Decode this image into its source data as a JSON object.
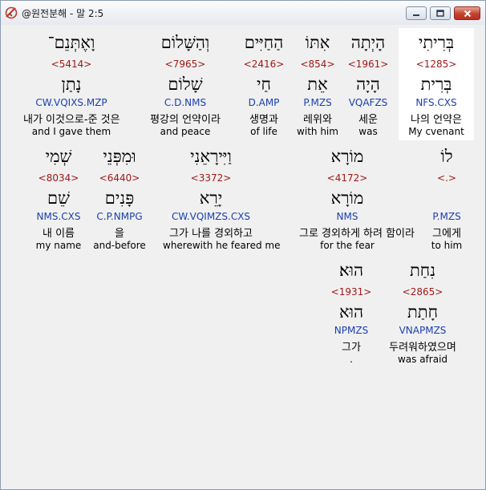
{
  "window": {
    "title": "@원전분해 - 말 2:5",
    "colors": {
      "strong": "#a01818",
      "parse": "#1a3fb0",
      "close_button": "#c4412f"
    }
  },
  "words": [
    {
      "heb": "בְּרִיתִי",
      "strong": "<1285>",
      "lemma": "בְּרִית",
      "parse": "NFS.CXS",
      "kor": "나의 언약은",
      "eng": "My cvenant",
      "selected": true
    },
    {
      "heb": "הָיְתָה",
      "strong": "<1961>",
      "lemma": "הָיָה",
      "parse": "VQAFZS",
      "kor": "세운",
      "eng": "was"
    },
    {
      "heb": "אִתּוֹ",
      "strong": "<854>",
      "lemma": "אֵת",
      "parse": "P.MZS",
      "kor": "레위와",
      "eng": "with him"
    },
    {
      "heb": "הַחַיִּים",
      "strong": "<2416>",
      "lemma": "חַי",
      "parse": "D.AMP",
      "kor": "생명과",
      "eng": "of life"
    },
    {
      "heb": "וְהַשָּׁלוֹם",
      "strong": "<7965>",
      "lemma": "שָׁלוֹם",
      "parse": "C.D.NMS",
      "kor": "평강의 언약이라",
      "eng": "and peace"
    },
    {
      "heb": "וָאֶתְּנֵם־",
      "strong": "<5414>",
      "lemma": "נָתַן",
      "parse": "CW.VQIXS.MZP",
      "kor": "내가 이것으로-준 것은",
      "eng": "and I gave them"
    },
    {
      "heb": "לוֹ",
      "strong": "<.>",
      "lemma": "",
      "parse": "P.MZS",
      "kor": "그에게",
      "eng": "to him"
    },
    {
      "heb": "מוֹרָא",
      "strong": "<4172>",
      "lemma": "מוֹרָא",
      "parse": "NMS",
      "kor": "그로 경외하게 하려 함이라",
      "eng": "for the fear"
    },
    {
      "heb": "וַיִּירָאֵנִי",
      "strong": "<3372>",
      "lemma": "יָרֵא",
      "parse": "CW.VQIMZS.CXS",
      "kor": "그가 나를 경외하고",
      "eng": "wherewith he feared me"
    },
    {
      "heb": "וּמִפְּנֵי",
      "strong": "<6440>",
      "lemma": "פָּנִים",
      "parse": "C.P.NMPG",
      "kor": "을",
      "eng": "and-before"
    },
    {
      "heb": "שְׁמִי",
      "strong": "<8034>",
      "lemma": "שֵׁם",
      "parse": "NMS.CXS",
      "kor": "내 이름",
      "eng": "my name"
    },
    {
      "heb": "נִחַת",
      "strong": "<2865>",
      "lemma": "חָתַת",
      "parse": "VNAPMZS",
      "kor": "두려워하였으며",
      "eng": "was afraid"
    },
    {
      "heb": "הוּא׃",
      "strong": "<1931>",
      "lemma": "הוּא",
      "parse": "NPMZS",
      "kor": "그가",
      "eng": "."
    }
  ]
}
